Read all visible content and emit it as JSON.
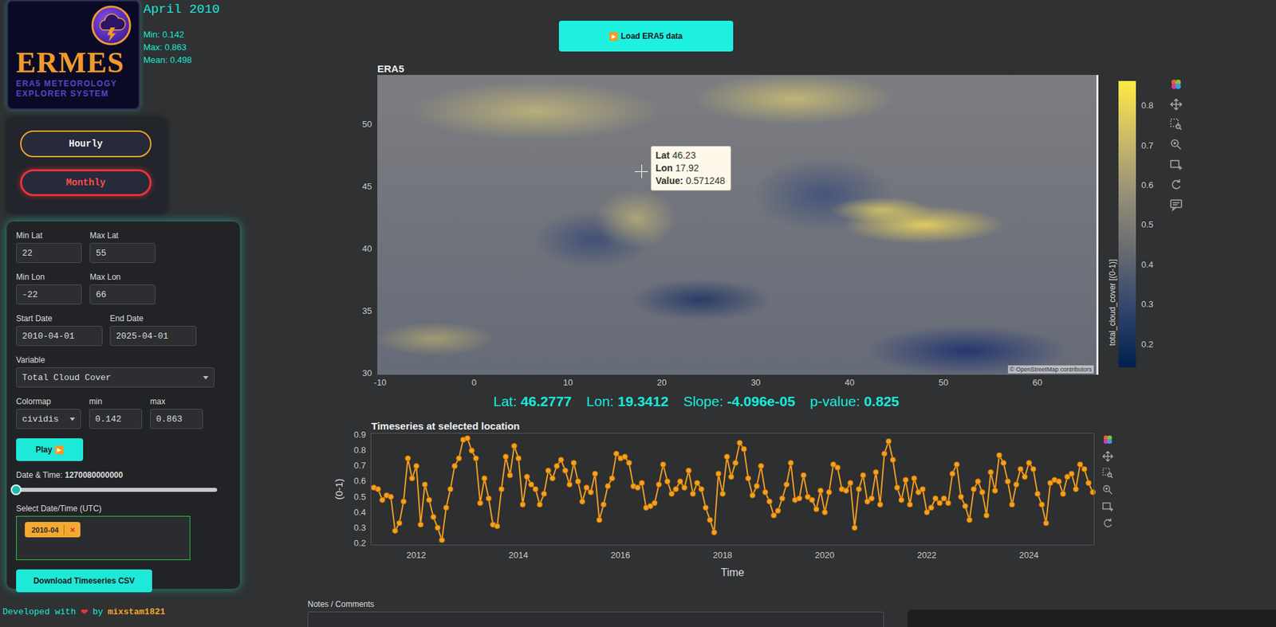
{
  "header": {
    "month": "April 2010",
    "stats": [
      "Min: 0.142",
      "Max: 0.863",
      "Mean: 0.498"
    ]
  },
  "logo": {
    "title": "ERMES",
    "subtitle": [
      "ERA5 METEOROLOGY",
      "EXPLORER SYSTEM"
    ]
  },
  "modes": [
    {
      "label": "Hourly",
      "selected": false
    },
    {
      "label": "Monthly",
      "selected": true
    }
  ],
  "controls": {
    "bounds": [
      {
        "label": "Min Lat",
        "value": "22"
      },
      {
        "label": "Max Lat",
        "value": "55"
      },
      {
        "label": "Min Lon",
        "value": "-22"
      },
      {
        "label": "Max Lon",
        "value": "66"
      }
    ],
    "dates": [
      {
        "label": "Start Date",
        "value": "2010-04-01"
      },
      {
        "label": "End Date",
        "value": "2025-04-01"
      }
    ],
    "variable": {
      "label": "Variable",
      "value": "Total Cloud Cover"
    },
    "colormap": {
      "label": "Colormap",
      "value": "cividis"
    },
    "range": [
      {
        "label": "min",
        "value": "0.142"
      },
      {
        "label": "max",
        "value": "0.863"
      }
    ],
    "play": {
      "label": "Play",
      "icon": "▶"
    },
    "slider": {
      "label": "Date & Time:",
      "value": "1270080000000",
      "level": 0
    },
    "select": {
      "label": "Select Date/Time (UTC)",
      "chips": [
        {
          "text": "2010-04",
          "remove": "×"
        }
      ]
    },
    "download": "Download Timeseries CSV"
  },
  "footer": {
    "text": "Developed with",
    "heart": "❤",
    "by": "by",
    "author": "mixstam1821"
  },
  "load_button": {
    "icon": "▶",
    "label": "Load ERA5 data"
  },
  "map": {
    "title": "ERA5",
    "x_range": [
      -10.3,
      66.5
    ],
    "y_range": [
      29.87,
      54.0
    ],
    "x_ticks": [
      "-10",
      "0",
      "10",
      "20",
      "30",
      "40",
      "50",
      "60"
    ],
    "y_ticks": [
      "50",
      "45",
      "40",
      "35",
      "30"
    ],
    "tooltip": {
      "lat_label": "Lat",
      "lat": "46.23",
      "lon_label": "Lon",
      "lon": "17.92",
      "value_label": "Value:",
      "value": "0.571248"
    },
    "attribution": "© OpenStreetMap contributors",
    "colorbar": {
      "min": 0.142,
      "max": 0.863,
      "ticks": [
        "0.8",
        "0.7",
        "0.6",
        "0.5",
        "0.4",
        "0.3",
        "0.2"
      ],
      "label": "total_cloud_cover [(0-1)]"
    }
  },
  "stats": [
    {
      "key": "Lat:",
      "value": "46.2777"
    },
    {
      "key": "Lon:",
      "value": "19.3412"
    },
    {
      "key": "Slope:",
      "value": "-4.096e-05"
    },
    {
      "key": "p-value:",
      "value": "0.825"
    }
  ],
  "timeseries": {
    "title": "Timeseries at selected location",
    "y_label": "(0-1)",
    "x_label": "Time",
    "x_range": [
      2011.12,
      2025.27
    ],
    "y_range": [
      0.19,
      0.91
    ],
    "first_time": 2011.17,
    "x_ticks": [
      "2012",
      "2014",
      "2016",
      "2018",
      "2020",
      "2022",
      "2024"
    ],
    "y_ticks": [
      "0.9",
      "0.8",
      "0.7",
      "0.6",
      "0.5",
      "0.4",
      "0.3",
      "0.2"
    ],
    "values": [
      0.56,
      0.55,
      0.48,
      0.51,
      0.5,
      0.28,
      0.33,
      0.47,
      0.75,
      0.62,
      0.7,
      0.32,
      0.58,
      0.48,
      0.37,
      0.3,
      0.22,
      0.43,
      0.55,
      0.7,
      0.75,
      0.87,
      0.88,
      0.8,
      0.75,
      0.46,
      0.62,
      0.49,
      0.32,
      0.31,
      0.55,
      0.76,
      0.64,
      0.83,
      0.75,
      0.45,
      0.63,
      0.58,
      0.55,
      0.45,
      0.52,
      0.67,
      0.62,
      0.7,
      0.74,
      0.67,
      0.58,
      0.72,
      0.6,
      0.47,
      0.56,
      0.53,
      0.65,
      0.35,
      0.45,
      0.57,
      0.62,
      0.78,
      0.75,
      0.76,
      0.72,
      0.57,
      0.56,
      0.59,
      0.43,
      0.44,
      0.46,
      0.58,
      0.71,
      0.6,
      0.52,
      0.55,
      0.6,
      0.56,
      0.67,
      0.52,
      0.59,
      0.55,
      0.43,
      0.35,
      0.27,
      0.65,
      0.52,
      0.76,
      0.63,
      0.72,
      0.85,
      0.81,
      0.62,
      0.51,
      0.57,
      0.7,
      0.53,
      0.47,
      0.38,
      0.41,
      0.49,
      0.58,
      0.72,
      0.48,
      0.49,
      0.64,
      0.5,
      0.48,
      0.42,
      0.54,
      0.4,
      0.53,
      0.71,
      0.69,
      0.55,
      0.54,
      0.59,
      0.3,
      0.55,
      0.64,
      0.47,
      0.49,
      0.66,
      0.45,
      0.78,
      0.86,
      0.74,
      0.56,
      0.48,
      0.61,
      0.45,
      0.62,
      0.53,
      0.55,
      0.4,
      0.43,
      0.49,
      0.46,
      0.49,
      0.46,
      0.65,
      0.71,
      0.5,
      0.44,
      0.35,
      0.55,
      0.6,
      0.53,
      0.38,
      0.66,
      0.54,
      0.77,
      0.72,
      0.6,
      0.45,
      0.58,
      0.68,
      0.63,
      0.72,
      0.68,
      0.52,
      0.45,
      0.33,
      0.59,
      0.61,
      0.6,
      0.52,
      0.63,
      0.65,
      0.55,
      0.71,
      0.68,
      0.59,
      0.53
    ]
  },
  "notes": {
    "label": "Notes / Comments"
  }
}
